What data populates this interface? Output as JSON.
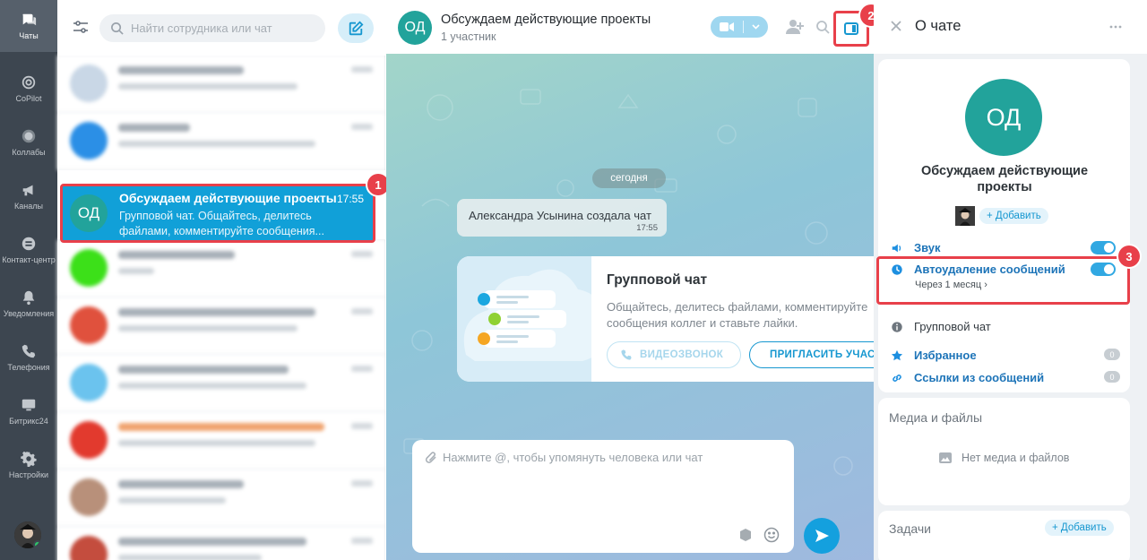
{
  "sidebar": {
    "items": [
      {
        "label": "Чаты",
        "icon": "chats-icon"
      },
      {
        "label": "CoPilot",
        "icon": "copilot-icon"
      },
      {
        "label": "Коллабы",
        "icon": "collabs-icon"
      },
      {
        "label": "Каналы",
        "icon": "channels-icon"
      },
      {
        "label": "Контакт-центр",
        "icon": "contact-center-icon"
      },
      {
        "label": "Уведомления",
        "icon": "bell-icon"
      },
      {
        "label": "Телефония",
        "icon": "phone-icon"
      },
      {
        "label": "Битрикс24",
        "icon": "monitor-icon"
      },
      {
        "label": "Настройки",
        "icon": "gear-icon"
      }
    ]
  },
  "chat_list": {
    "search_placeholder": "Найти сотрудника или чат",
    "active_chat": {
      "avatar_initials": "ОД",
      "title": "Обсуждаем действующие проекты",
      "time": "17:55",
      "preview": "Групповой чат. Общайтесь, делитесь файлами, комментируйте сообщения..."
    }
  },
  "chat": {
    "header": {
      "avatar_initials": "ОД",
      "title": "Обсуждаем действующие проекты",
      "subtitle": "1 участник"
    },
    "date_divider": "сегодня",
    "system_message": {
      "text": "Александра Усынина создала чат",
      "time": "17:55"
    },
    "group_card": {
      "title": "Групповой чат",
      "text": "Общайтесь, делитесь файлами, комментируйте сообщения коллег и ставьте лайки.",
      "video_button": "ВИДЕОЗВОНОК",
      "invite_button": "ПРИГЛАСИТЬ УЧАСТНИКОВ"
    },
    "composer_placeholder": "Нажмите @, чтобы упомянуть человека или чат"
  },
  "info_panel": {
    "title": "О чате",
    "avatar_initials": "ОД",
    "chat_name": "Обсуждаем действующие проекты",
    "add_label": "+ Добавить",
    "settings": {
      "sound": "Звук",
      "autodelete": "Автоудаление сообщений",
      "autodelete_value": "Через 1 месяц",
      "type": "Групповой чат",
      "favorites": "Избранное",
      "favorites_count": "0",
      "links": "Ссылки из сообщений",
      "links_count": "0"
    },
    "media": {
      "title": "Медиа и файлы",
      "empty": "Нет медиа и файлов"
    },
    "tasks": {
      "title": "Задачи",
      "add_label": "+ Добавить"
    }
  },
  "callouts": [
    "1",
    "2",
    "3"
  ],
  "colors": {
    "accent": "#11a0d8",
    "callout": "#e8404a",
    "avatar": "#22a39b",
    "rail": "#3d4650"
  }
}
